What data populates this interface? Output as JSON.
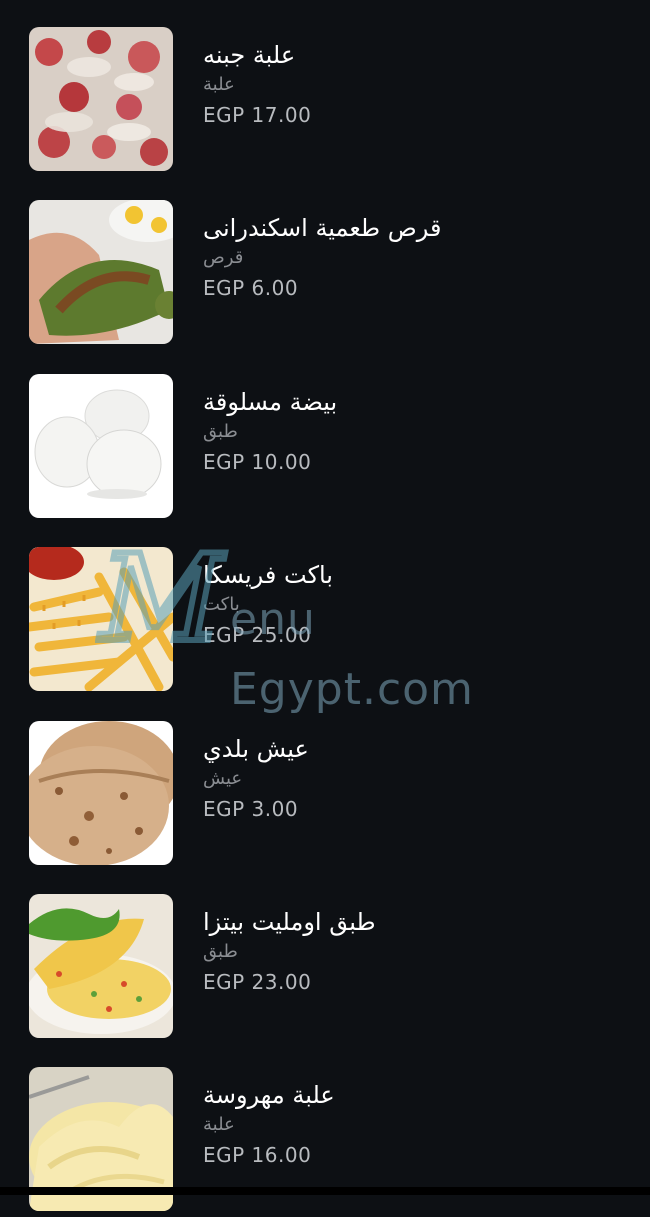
{
  "watermark": {
    "initial": "M",
    "text": "enu Egypt.com"
  },
  "items": [
    {
      "name": "علبة جبنه",
      "unit": "علبة",
      "price": "EGP 17.00",
      "image": "cheese-tomato-photo"
    },
    {
      "name": "قرص طعمية اسكندرانى",
      "unit": "قرص",
      "price": "EGP 6.00",
      "image": "falafel-photo"
    },
    {
      "name": "بيضة مسلوقة",
      "unit": "طبق",
      "price": "EGP 10.00",
      "image": "boiled-eggs-photo"
    },
    {
      "name": "باكت فريسكا",
      "unit": "باكت",
      "price": "EGP 25.00",
      "image": "fries-photo"
    },
    {
      "name": "عيش بلدي",
      "unit": "عيش",
      "price": "EGP 3.00",
      "image": "baladi-bread-photo"
    },
    {
      "name": "طبق اومليت بيتزا",
      "unit": "طبق",
      "price": "EGP 23.00",
      "image": "omelette-photo"
    },
    {
      "name": "علبة مهروسة",
      "unit": "علبة",
      "price": "EGP 16.00",
      "image": "mashed-potato-photo"
    }
  ]
}
